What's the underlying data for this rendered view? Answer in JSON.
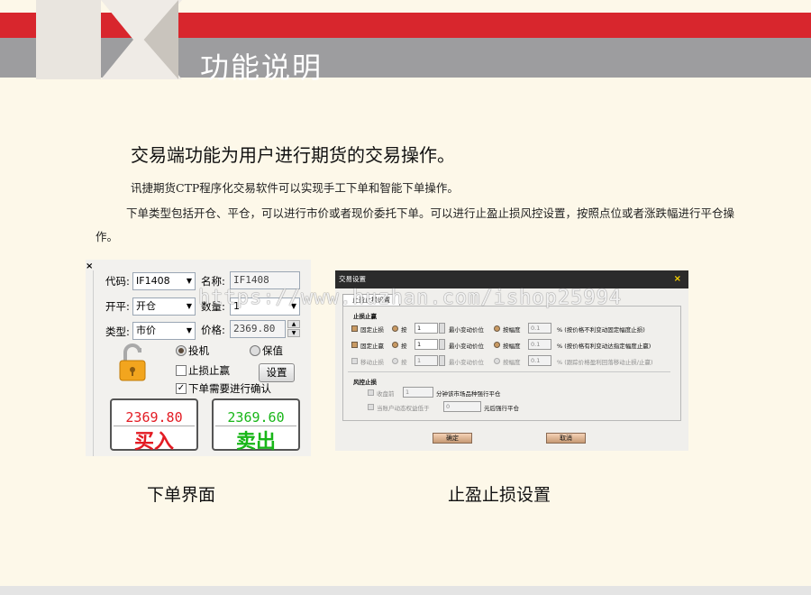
{
  "header": {
    "title": "功能说明"
  },
  "headline": "交易端功能为用户进行期货的交易操作。",
  "paragraph1": "讯捷期货CTP程序化交易软件可以实现手工下单和智能下单操作。",
  "paragraph2": "下单类型包括开仓、平仓，可以进行市价或者现价委托下单。可以进行止盈止损风控设置，按照点位或者涨跌幅进行平仓操作。",
  "order_panel": {
    "close_glyph": "×",
    "code_label": "代码:",
    "code_value": "IF1408",
    "name_label": "名称:",
    "name_value": "IF1408",
    "open_close_label": "开平:",
    "open_close_value": "开仓",
    "qty_label": "数量:",
    "qty_value": "1",
    "type_label": "类型:",
    "type_value": "市价",
    "price_label": "价格:",
    "price_value": "2369.80",
    "speculate_label": "投机",
    "hedge_label": "保值",
    "stoploss_label": "止损止赢",
    "settings_button": "设置",
    "confirm_label": "下单需要进行确认",
    "buy_price": "2369.80",
    "buy_label": "买入",
    "sell_price": "2369.60",
    "sell_label": "卖出",
    "colors": {
      "buy": "#e31b23",
      "sell": "#18b618"
    }
  },
  "settings_dialog": {
    "title": "交易设置",
    "close_glyph": "×",
    "tab": "止盈止损设置",
    "group1": "止损止赢",
    "rows": [
      {
        "check": "固定止损",
        "radio": "按",
        "value": "1",
        "unit": "最小变动价位",
        "radio2": "按幅度",
        "pct": "0.1",
        "desc": "% (按价格不利变动固定幅度止损)"
      },
      {
        "check": "固定止赢",
        "radio": "按",
        "value": "1",
        "unit": "最小变动价位",
        "radio2": "按幅度",
        "pct": "0.1",
        "desc": "% (按价格有利变动达指定幅度止赢)"
      },
      {
        "check": "移动止损",
        "radio": "按",
        "value": "1",
        "unit": "最小变动价位",
        "radio2": "按幅度",
        "pct": "0.1",
        "desc": "% (跟踪价格盈利回落移动止损/止赢)"
      }
    ],
    "group2": "风控止损",
    "risk_rows": [
      {
        "check": "收盘前",
        "value": "1",
        "desc": "分钟该市场品种强行平仓"
      },
      {
        "check": "当账户动态权益低于",
        "value": "0",
        "desc": "元后强行平仓"
      }
    ],
    "ok": "确定",
    "cancel": "取消"
  },
  "watermark": "https://www.huzhan.com/ishop25994",
  "captions": {
    "left": "下单界面",
    "right": "止盈止损设置"
  }
}
